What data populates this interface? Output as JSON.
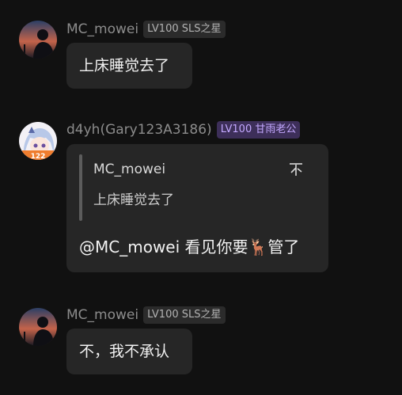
{
  "messages": [
    {
      "username": "MC_mowei",
      "badge": "LV100 SLS之星",
      "text": "上床睡觉去了"
    },
    {
      "username": "d4yh(Gary123A3186)",
      "badge": "LV100 甘雨老公",
      "avatar_label": "122",
      "quote": {
        "username": "MC_mowei",
        "text": "上床睡觉去了",
        "icon": "不"
      },
      "reply_prefix": "@MC_mowei 看见你要",
      "reply_emoji": "🦌",
      "reply_suffix": "管了"
    },
    {
      "username": "MC_mowei",
      "badge": "LV100 SLS之星",
      "text": "不，我不承认"
    }
  ],
  "colors": {
    "background": "#111111",
    "bubble": "#262626",
    "badge_gray": "#2b2b2b",
    "badge_purple": "#3d2f59",
    "badge_purple_text": "#c3a8ff"
  }
}
